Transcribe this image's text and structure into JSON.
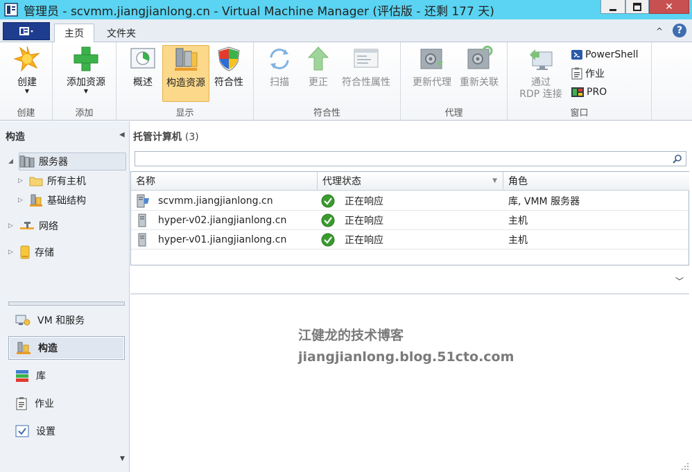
{
  "window": {
    "title": "管理员 - scvmm.jiangjianlong.cn - Virtual Machine Manager (评估版 - 还剩 177 天)",
    "close_glyph": "✕"
  },
  "ribbon": {
    "tabs": [
      {
        "label": "主页",
        "active": true
      },
      {
        "label": "文件夹",
        "active": false
      }
    ],
    "collapse_glyph": "^",
    "help_glyph": "?",
    "groups": {
      "create": {
        "label": "创建",
        "buttons": [
          {
            "label": "创建",
            "icon": "starburst-icon",
            "dropdown": true
          }
        ]
      },
      "add": {
        "label": "添加",
        "buttons": [
          {
            "label": "添加资源",
            "icon": "green-plus-icon",
            "dropdown": true
          }
        ]
      },
      "show": {
        "label": "显示",
        "buttons": [
          {
            "label": "概述",
            "icon": "overview-chart-icon"
          },
          {
            "label": "构造资源",
            "icon": "fabric-resources-icon",
            "active": true
          },
          {
            "label": "符合性",
            "icon": "shield-icon"
          }
        ]
      },
      "compliance": {
        "label": "符合性",
        "buttons": [
          {
            "label": "扫描",
            "icon": "scan-icon",
            "disabled": true
          },
          {
            "label": "更正",
            "icon": "remediate-arrow-icon",
            "disabled": true
          },
          {
            "label": "符合性属性",
            "icon": "compliance-properties-icon",
            "disabled": true
          }
        ]
      },
      "agent": {
        "label": "代理",
        "buttons": [
          {
            "label": "更新代理",
            "icon": "update-agent-icon",
            "disabled": true
          },
          {
            "label": "重新关联",
            "icon": "reassociate-icon",
            "disabled": true
          }
        ]
      },
      "window": {
        "label": "窗口",
        "buttons": [
          {
            "label": "通过",
            "label2": "RDP 连接",
            "icon": "rdp-connect-icon",
            "disabled": true
          },
          {
            "label": "PowerShell",
            "icon": "powershell-icon"
          },
          {
            "label": "作业",
            "icon": "jobs-clipboard-icon"
          },
          {
            "label": "PRO",
            "icon": "pro-icon"
          }
        ]
      }
    }
  },
  "nav": {
    "header": "构造",
    "tree": [
      {
        "label": "服务器",
        "expanded": true,
        "selected": true,
        "icon": "servers-icon"
      },
      {
        "label": "所有主机",
        "icon": "folder-icon"
      },
      {
        "label": "基础结构",
        "icon": "infrastructure-icon"
      },
      {
        "label": "网络",
        "icon": "network-icon"
      },
      {
        "label": "存储",
        "icon": "storage-icon"
      }
    ],
    "workspaces": [
      {
        "label": "VM 和服务",
        "icon": "vm-services-icon"
      },
      {
        "label": "构造",
        "icon": "fabric-icon",
        "active": true
      },
      {
        "label": "库",
        "icon": "library-books-icon"
      },
      {
        "label": "作业",
        "icon": "jobs-icon"
      },
      {
        "label": "设置",
        "icon": "settings-check-icon"
      }
    ]
  },
  "main": {
    "title": "托管计算机",
    "count": "(3)",
    "search": {
      "value": "",
      "placeholder": ""
    },
    "columns": [
      "名称",
      "代理状态",
      "角色"
    ],
    "rows": [
      {
        "name": "scvmm.jiangjianlong.cn",
        "status": "正在响应",
        "role": "库, VMM 服务器",
        "icon": "vmm-server-icon"
      },
      {
        "name": "hyper-v02.jiangjianlong.cn",
        "status": "正在响应",
        "role": "主机",
        "icon": "host-server-icon"
      },
      {
        "name": "hyper-v01.jiangjianlong.cn",
        "status": "正在响应",
        "role": "主机",
        "icon": "host-server-icon"
      }
    ]
  },
  "watermark": {
    "line1": "江健龙的技术博客",
    "line2": "jiangjianlong.blog.51cto.com"
  },
  "colors": {
    "titlebar": "#5ad4f2",
    "active_button": "#fbd88a",
    "status_ok": "#3a9b2e",
    "file_menu": "#1e3d8f"
  }
}
